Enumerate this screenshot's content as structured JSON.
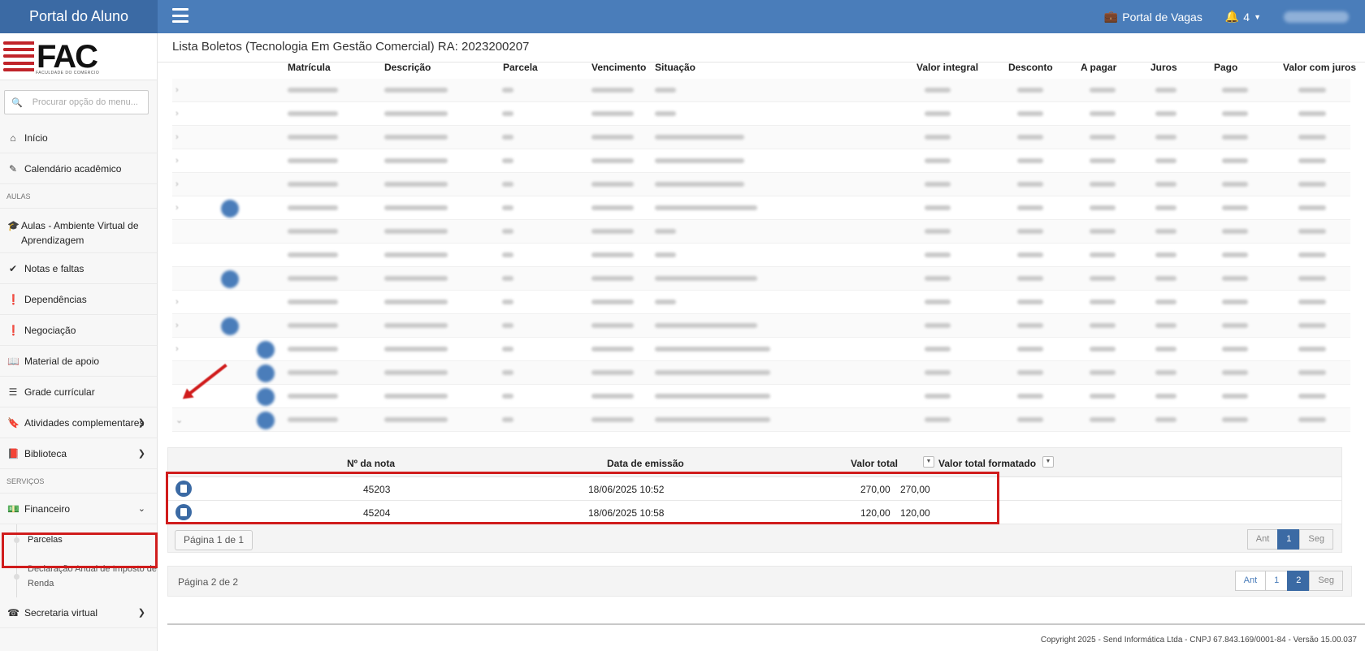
{
  "header": {
    "brand": "Portal do Aluno",
    "portal_vagas": "Portal de Vagas",
    "notifications_count": "4"
  },
  "sidebar": {
    "logo_text": "FAC",
    "logo_sub": "FACULDADE DO COMÉRCIO",
    "search_placeholder": "Procurar opção do menu...",
    "items": {
      "inicio": "Início",
      "calendario": "Calendário acadêmico",
      "section_aulas": "AULAS",
      "aulas_ava": "Aulas - Ambiente Virtual de Aprendizagem",
      "notas": "Notas e faltas",
      "dependencias": "Dependências",
      "negociacao": "Negociação",
      "material": "Material de apoio",
      "grade": "Grade currícular",
      "atividades": "Atividades complementares",
      "biblioteca": "Biblioteca",
      "section_servicos": "SERVIÇOS",
      "financeiro": "Financeiro",
      "parcelas": "Parcelas",
      "declaracao": "Declaração Anual de Imposto de Renda",
      "secretaria": "Secretaria virtual"
    }
  },
  "main": {
    "title": "Lista Boletos (Tecnologia Em Gestão Comercial) RA: 2023200207",
    "columns": {
      "matricula": "Matrícula",
      "descricao": "Descrição",
      "parcela": "Parcela",
      "vencimento": "Vencimento",
      "situacao": "Situação",
      "valor_integral": "Valor integral",
      "desconto": "Desconto",
      "a_pagar": "A pagar",
      "juros": "Juros",
      "pago": "Pago",
      "valor_com_juros": "Valor com juros"
    },
    "nested": {
      "columns": {
        "nota": "Nº da nota",
        "emissao": "Data de emissão",
        "valor_total": "Valor total",
        "valor_formatado": "Valor total formatado"
      },
      "rows": [
        {
          "nota": "45203",
          "emissao": "18/06/2025 10:52",
          "valor_total": "270,00",
          "valor_formatado": "270,00"
        },
        {
          "nota": "45204",
          "emissao": "18/06/2025 10:58",
          "valor_total": "120,00",
          "valor_formatado": "120,00"
        }
      ],
      "page_label": "Página 1 de 1",
      "pager": {
        "prev": "Ant",
        "current": "1",
        "next": "Seg"
      }
    },
    "outer_page_label": "Página 2 de 2",
    "outer_pager": {
      "prev": "Ant",
      "p1": "1",
      "p2": "2",
      "next": "Seg"
    }
  },
  "footer": {
    "copyright": "Copyright 2025 - Send Informática Ltda - CNPJ 67.843.169/0001-84 - Versão 15.00.037"
  }
}
